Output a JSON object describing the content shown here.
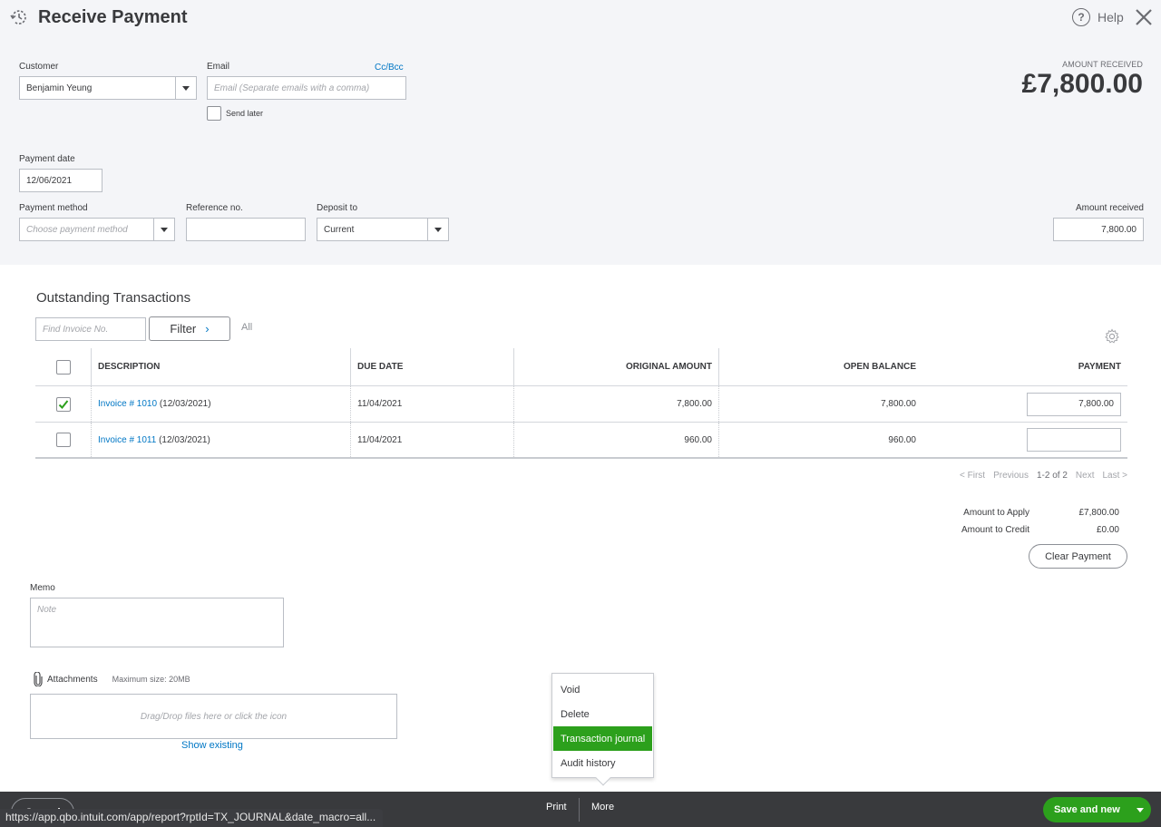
{
  "header": {
    "title": "Receive Payment",
    "help_label": "Help",
    "amount_received_caption": "AMOUNT RECEIVED",
    "amount_received_total": "£7,800.00"
  },
  "form": {
    "customer_label": "Customer",
    "customer_value": "Benjamin Yeung",
    "email_label": "Email",
    "email_placeholder": "Email (Separate emails with a comma)",
    "ccbcc_label": "Cc/Bcc",
    "send_later_label": "Send later",
    "send_later_checked": false,
    "payment_date_label": "Payment date",
    "payment_date_value": "12/06/2021",
    "payment_method_label": "Payment method",
    "payment_method_placeholder": "Choose payment method",
    "reference_label": "Reference no.",
    "reference_value": "",
    "deposit_to_label": "Deposit to",
    "deposit_to_value": "Current",
    "amount_received_label": "Amount received",
    "amount_received_value": "7,800.00"
  },
  "outstanding": {
    "title": "Outstanding Transactions",
    "find_placeholder": "Find Invoice No.",
    "filter_label": "Filter",
    "filter_state": "All",
    "columns": [
      "DESCRIPTION",
      "DUE DATE",
      "ORIGINAL AMOUNT",
      "OPEN BALANCE",
      "PAYMENT"
    ],
    "rows": [
      {
        "checked": true,
        "invoice_link": "Invoice # 1010",
        "invoice_date": "(12/03/2021)",
        "due_date": "11/04/2021",
        "original_amount": "7,800.00",
        "open_balance": "7,800.00",
        "payment": "7,800.00"
      },
      {
        "checked": false,
        "invoice_link": "Invoice # 1011",
        "invoice_date": "(12/03/2021)",
        "due_date": "11/04/2021",
        "original_amount": "960.00",
        "open_balance": "960.00",
        "payment": ""
      }
    ],
    "pager": {
      "first": "< First",
      "previous": "Previous",
      "range": "1-2 of 2",
      "next": "Next",
      "last": "Last >"
    }
  },
  "summary": {
    "apply_label": "Amount to Apply",
    "apply_value": "£7,800.00",
    "credit_label": "Amount to Credit",
    "credit_value": "£0.00",
    "clear_label": "Clear Payment"
  },
  "memo": {
    "label": "Memo",
    "placeholder": "Note"
  },
  "attachments": {
    "label": "Attachments",
    "max_size": "Maximum size: 20MB",
    "dropzone_text": "Drag/Drop files here or click the icon",
    "show_existing": "Show existing"
  },
  "more_menu": {
    "items": [
      "Void",
      "Delete",
      "Transaction journal",
      "Audit history"
    ],
    "highlighted": "Transaction journal"
  },
  "footer": {
    "cancel_label": "Cancel",
    "print_label": "Print",
    "more_label": "More",
    "save_label": "Save and new"
  },
  "status_bar": {
    "url": "https://app.qbo.intuit.com/app/report?rptId=TX_JOURNAL&date_macro=all..."
  },
  "colors": {
    "accent_green": "#2ca01c",
    "link_blue": "#0077c5",
    "footer_bg": "#393a3d",
    "panel_bg": "#f4f5f8"
  }
}
